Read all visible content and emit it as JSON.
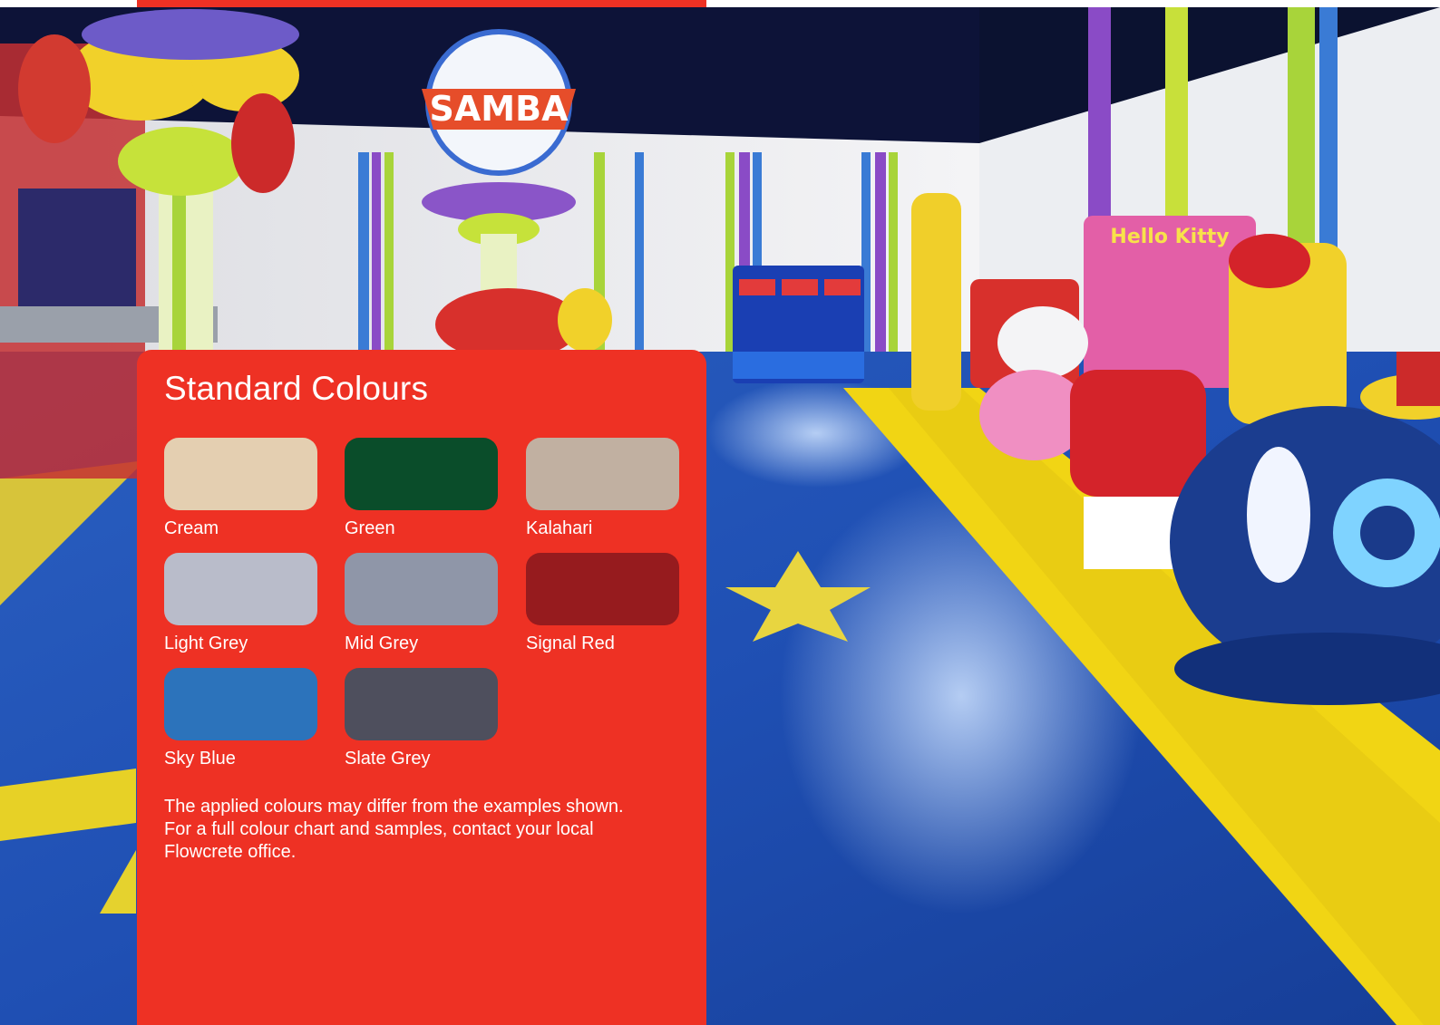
{
  "panel": {
    "title": "Standard Colours",
    "swatches": [
      {
        "name": "Cream",
        "color": "#e4cfb1"
      },
      {
        "name": "Green",
        "color": "#0a4d2a"
      },
      {
        "name": "Kalahari",
        "color": "#c1b0a1"
      },
      {
        "name": "Light Grey",
        "color": "#b9bcca"
      },
      {
        "name": "Mid Grey",
        "color": "#8f96a8"
      },
      {
        "name": "Signal Red",
        "color": "#961b1e"
      },
      {
        "name": "Sky Blue",
        "color": "#2c73bb"
      },
      {
        "name": "Slate Grey",
        "color": "#4e4f5d"
      }
    ],
    "disclaimer": [
      "The applied colours may differ from the examples shown.",
      "For a full colour chart and samples, contact your local",
      "Flowcrete office."
    ]
  },
  "photo": {
    "sign_text": "SAMBA",
    "ride_sign_text": "Hello Kitty"
  },
  "colors": {
    "accent": "#ee3124"
  }
}
